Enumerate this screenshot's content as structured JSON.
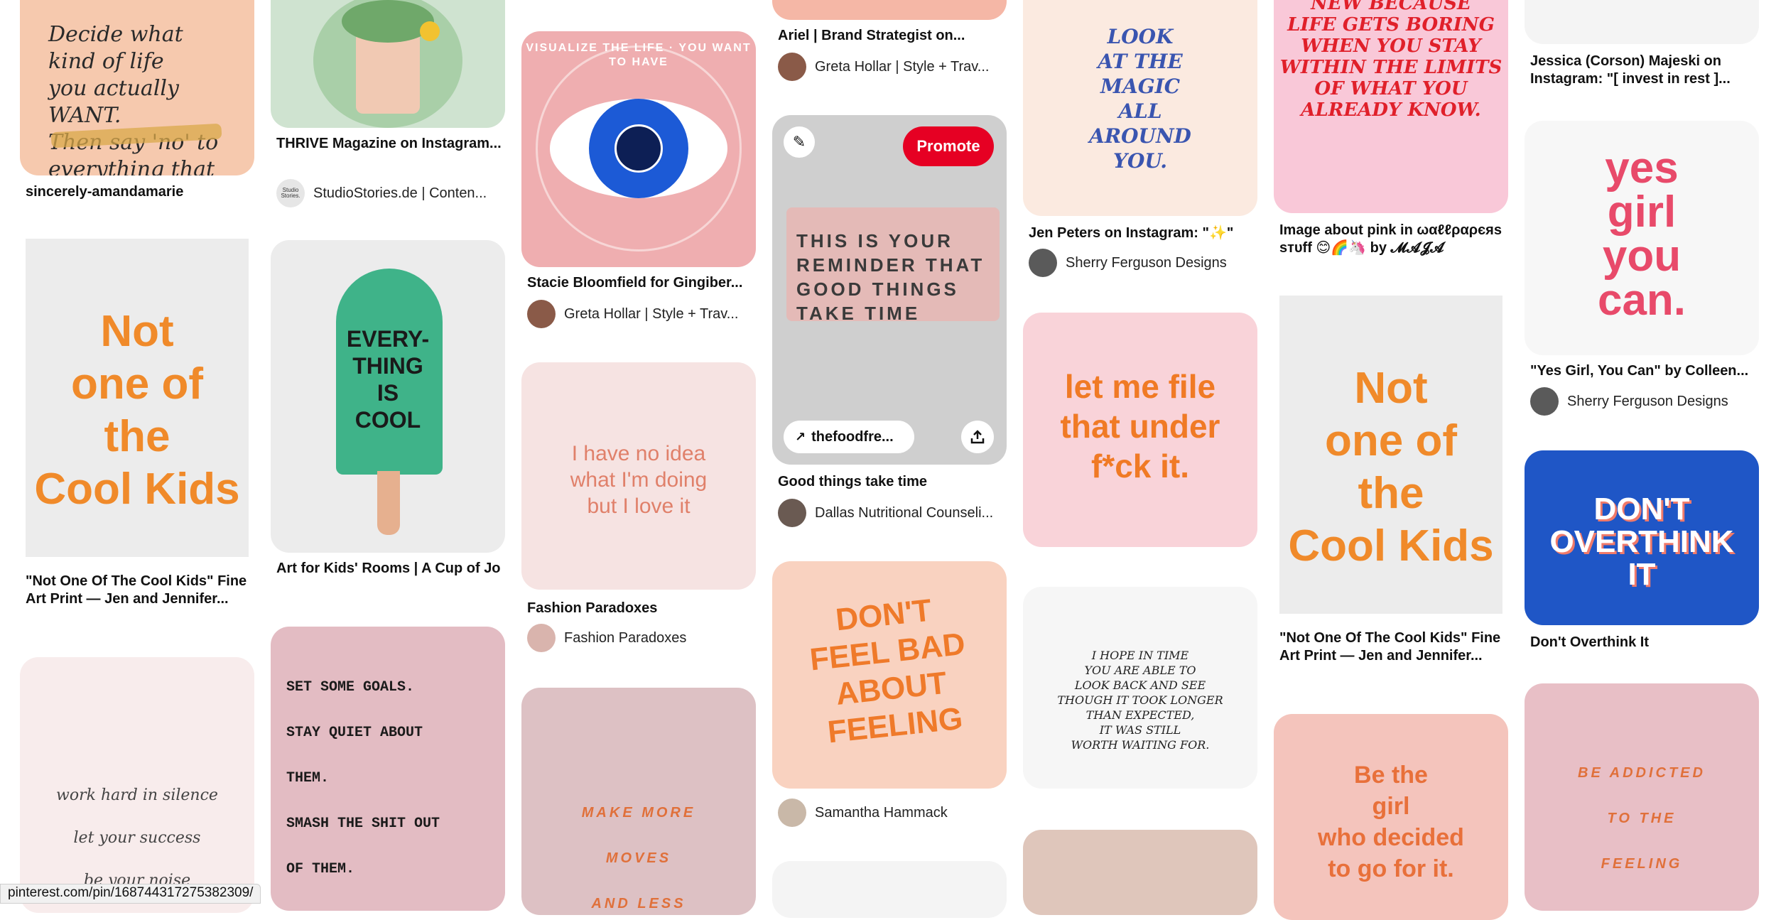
{
  "columns": {
    "c1": [
      {
        "image": {
          "text": "Decide what\nkind of life\nyou actually\nWANT.\nThen say 'no' to\neverything that isn't that",
          "bg": "#f6c9ae",
          "fg": "#2a2a2a"
        },
        "title": "sincerely-amandamarie",
        "attribution": null
      },
      {
        "image": {
          "text": "Not\none of\nthe\nCool Kids",
          "bg": "#ececec",
          "fg": "#f08a2a"
        },
        "title": "\"Not One Of The Cool Kids\" Fine Art Print — Jen and Jennifer...",
        "attribution": null
      },
      {
        "image": {
          "text": "work hard in silence\n\nlet your success\n\nbe your noise",
          "bg": "#f8ecec",
          "fg": "#444"
        },
        "title": "",
        "attribution": null
      }
    ],
    "c2": [
      {
        "image": {
          "text": "",
          "bg": "#cfe3d0",
          "fg": "#2e2e2e"
        },
        "title": "THRIVE Magazine on Instagram...",
        "attribution": {
          "name": "StudioStories.de | Conten...",
          "avatar_color": "#e6e6e6",
          "avatar_text": "Studio Stories."
        }
      },
      {
        "image": {
          "text": "EVERY-\nTHING\nIS\nCOOL",
          "bg": "#ececec",
          "fg": "#1a1a1a"
        },
        "title": "Art for Kids' Rooms | A Cup of Jo",
        "attribution": null
      },
      {
        "image": {
          "text": "SET SOME GOALS.\n\nSTAY QUIET ABOUT\n\nTHEM.\n\nSMASH THE SHIT OUT\n\nOF THEM.",
          "bg": "#e3bcc3",
          "fg": "#1a1a1a"
        },
        "title": "",
        "attribution": null
      }
    ],
    "c3": [
      {
        "image": {
          "text": "VISUALIZE THE LIFE · YOU WANT TO HAVE",
          "bg": "#efaeb0",
          "fg": "#ffffff"
        },
        "title": "Stacie Bloomfield for Gingiber...",
        "attribution": {
          "name": "Greta Hollar | Style + Trav...",
          "avatar_color": "#8a5a48",
          "avatar_text": ""
        }
      },
      {
        "image": {
          "text": "I have no idea\nwhat I'm doing\nbut I love it",
          "bg": "#f6e3e2",
          "fg": "#e0806a"
        },
        "title": "Fashion Paradoxes",
        "attribution": {
          "name": "Fashion Paradoxes",
          "avatar_color": "#d9b4ad",
          "avatar_text": ""
        }
      },
      {
        "image": {
          "text": "MAKE MORE\n\nMOVES\n\nAND LESS",
          "bg": "#ddc1c4",
          "fg": "#e0703a"
        },
        "title": "",
        "attribution": null
      }
    ],
    "c4": [
      {
        "image": {
          "text": "",
          "bg": "#f5b7a6",
          "fg": "#222"
        },
        "title": "Ariel | Brand Strategist on...",
        "attribution": {
          "name": "Greta Hollar | Style + Trav...",
          "avatar_color": "#8a5a48",
          "avatar_text": ""
        }
      },
      {
        "image": {
          "text": "THIS IS YOUR\nREMINDER THAT\nGOOD THINGS\nTAKE TIME",
          "bg": "#cfcfcf",
          "fg": "#3a3a3a"
        },
        "title": "Good things take time",
        "attribution": {
          "name": "Dallas Nutritional Counseli...",
          "avatar_color": "#6a5a52",
          "avatar_text": ""
        },
        "overlay": {
          "promote_label": "Promote",
          "link_label": "thefoodfre...",
          "edit_icon": "pencil-icon",
          "share_icon": "share-icon"
        }
      },
      {
        "image": {
          "text": "DON'T\nFEEL BAD\nABOUT\nFEELING",
          "bg": "#f9d2c0",
          "fg": "#ef7a2a"
        },
        "title": "",
        "attribution": {
          "name": "Samantha Hammack",
          "avatar_color": "#c9b8a8",
          "avatar_text": ""
        }
      },
      {
        "image": {
          "text": "",
          "bg": "#f4f4f4",
          "fg": "#222"
        },
        "title": "",
        "attribution": null
      }
    ],
    "c5": [
      {
        "image": {
          "text": "LOOK\nAT THE\nMAGIC\nALL\nAROUND\nYOU.",
          "bg": "#fbeae0",
          "fg": "#3a55b0"
        },
        "title": "Jen Peters on Instagram: \"✨\"",
        "attribution": {
          "name": "Sherry Ferguson Designs",
          "avatar_color": "#5a5a5a",
          "avatar_text": ""
        }
      },
      {
        "image": {
          "text": "let me file\nthat under\nf*ck it.",
          "bg": "#f9d3d9",
          "fg": "#f07a25"
        },
        "title": "",
        "attribution": null
      },
      {
        "image": {
          "text": "I HOPE IN TIME\nYOU ARE ABLE TO\nLOOK BACK AND SEE\nTHOUGH IT TOOK LONGER\nTHAN EXPECTED,\nIT WAS STILL\nWORTH WAITING FOR.",
          "bg": "#f6f6f6",
          "fg": "#222"
        },
        "title": "",
        "attribution": null
      },
      {
        "image": {
          "text": "",
          "bg": "#dfc6bb",
          "fg": "#222"
        },
        "title": "",
        "attribution": null
      }
    ],
    "c6": [
      {
        "image": {
          "text": "NEW BECAUSE\nLIFE GETS BORING\nWHEN YOU STAY\nWITHIN THE LIMITS\nOF WHAT YOU\nALREADY KNOW.",
          "bg": "#f9c8d8",
          "fg": "#e0202a"
        },
        "title": "Image about pink in ωαℓℓραρєяѕ ѕтυff 😊🌈🦄 by 𝓜𝓐𝓙𝓐",
        "attribution": null
      },
      {
        "image": {
          "text": "Not\none of\nthe\nCool Kids",
          "bg": "#ececec",
          "fg": "#f08a2a"
        },
        "title": "\"Not One Of The Cool Kids\" Fine Art Print — Jen and Jennifer...",
        "attribution": null
      },
      {
        "image": {
          "text": "Be the\ngirl\nwho decided\nto go for it.",
          "bg": "#f4c4bc",
          "fg": "#e8703a"
        },
        "title": "",
        "attribution": null
      }
    ],
    "c7": [
      {
        "image": {
          "text": "",
          "bg": "#f4f4f4",
          "fg": "#222"
        },
        "title": "Jessica (Corson) Majeski on Instagram: \"[ invest in rest ]...",
        "attribution": null
      },
      {
        "image": {
          "text": "yes\ngirl\nyou\ncan.",
          "bg": "#f7f7f7",
          "fg": "#e84a6a"
        },
        "title": "\"Yes Girl, You Can\" by Colleen...",
        "attribution": {
          "name": "Sherry Ferguson Designs",
          "avatar_color": "#5a5a5a",
          "avatar_text": ""
        }
      },
      {
        "image": {
          "text": "DON'T\nOVERTHINK\nIT",
          "bg": "#1f56c6",
          "fg": "#ffffff"
        },
        "title": "Don't Overthink It",
        "attribution": null
      },
      {
        "image": {
          "text": "BE ADDICTED\n\nTO THE\n\nFEELING",
          "bg": "#e8bfc6",
          "fg": "#e0703a"
        },
        "title": "",
        "attribution": null
      }
    ]
  },
  "status_url": "pinterest.com/pin/168744317275382309/"
}
